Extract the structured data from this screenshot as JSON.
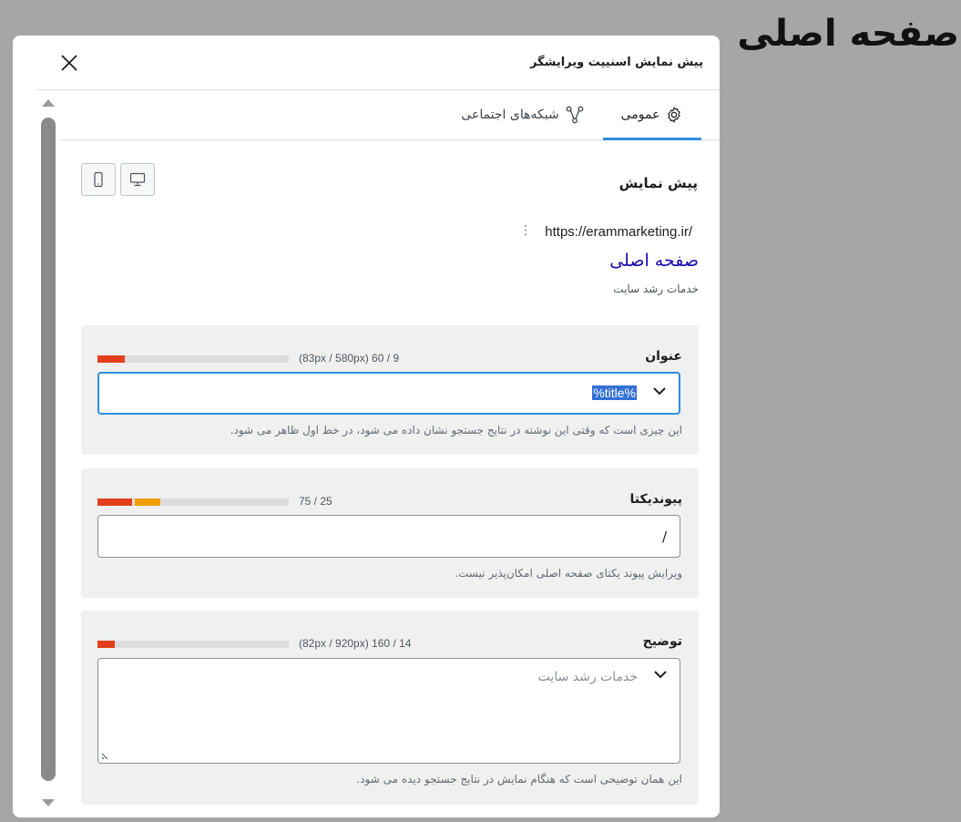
{
  "page": {
    "heading": "صفحه اصلی"
  },
  "modal": {
    "title": "پیش نمایش اسنیپت ویرایشگر",
    "tabs": [
      {
        "label": "عمومی",
        "icon": "gear-icon",
        "active": true
      },
      {
        "label": "شبکه‌های اجتماعی",
        "icon": "share-icon",
        "active": false
      }
    ],
    "preview_label": "پیش نمایش",
    "devices": [
      "desktop-icon",
      "mobile-icon"
    ]
  },
  "serp": {
    "url": "https://erammarketing.ir/",
    "title": "صفحه اصلی",
    "description": "خدمات رشد سایت"
  },
  "fields": {
    "title": {
      "label": "عنوان",
      "meta": "(83px / 580px) 60 / 9",
      "value": "%title%",
      "help": "این چیزی است که وقتی این نوشته در نتایج جستجو نشان داده می شود، در خط اول ظاهر می شود.",
      "progress": 0.143,
      "bar_color": "#e2401c"
    },
    "slug": {
      "label": "پیوندیکتا",
      "meta": "75 / 25",
      "value": "/",
      "help": "ویرایش پیوند یکتای صفحه اصلی امکان‌پذیر نیست.",
      "progress": 0.333,
      "bar_colors": [
        "#e2401c",
        "#f0a000"
      ]
    },
    "description": {
      "label": "توضیح",
      "meta": "(82px / 920px) 160 / 14",
      "placeholder": "خدمات رشد سایت",
      "help": "این همان توضیحی است که هنگام نمایش در نتایج جستجو دیده می شود.",
      "progress": 0.089,
      "bar_color": "#e2401c"
    }
  }
}
